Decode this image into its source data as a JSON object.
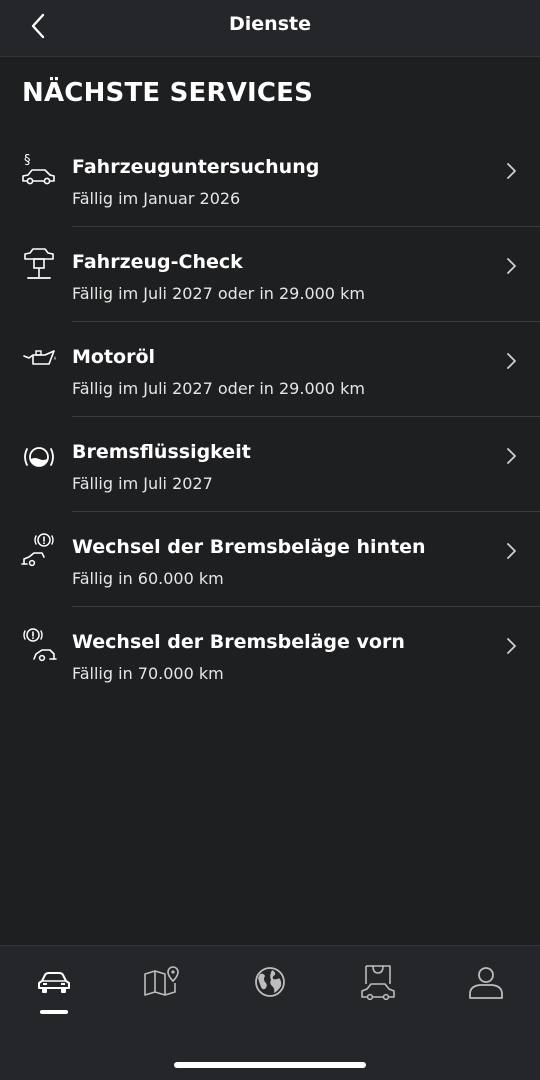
{
  "header": {
    "title": "Dienste",
    "back_icon": "chevron-left-icon"
  },
  "section": {
    "title": "NÄCHSTE SERVICES"
  },
  "services": [
    {
      "icon": "vehicle-inspection-icon",
      "title": "Fahrzeuguntersuchung",
      "subtitle": "Fällig im Januar 2026"
    },
    {
      "icon": "vehicle-lift-icon",
      "title": "Fahrzeug-Check",
      "subtitle": "Fällig im Juli 2027 oder in 29.000 km"
    },
    {
      "icon": "oil-can-icon",
      "title": "Motoröl",
      "subtitle": "Fällig im Juli 2027 oder in 29.000 km"
    },
    {
      "icon": "brake-fluid-icon",
      "title": "Bremsflüssigkeit",
      "subtitle": "Fällig im Juli 2027"
    },
    {
      "icon": "rear-brake-pads-icon",
      "title": "Wechsel der Bremsbeläge hinten",
      "subtitle": "Fällig in 60.000 km"
    },
    {
      "icon": "front-brake-pads-icon",
      "title": "Wechsel der Bremsbeläge vorn",
      "subtitle": "Fällig in 70.000 km"
    }
  ],
  "bottom_nav": {
    "tabs": [
      {
        "icon": "car-icon",
        "active": true
      },
      {
        "icon": "map-icon",
        "active": false
      },
      {
        "icon": "globe-icon",
        "active": false
      },
      {
        "icon": "shop-icon",
        "active": false
      },
      {
        "icon": "profile-icon",
        "active": false
      }
    ]
  },
  "colors": {
    "background": "#1e1f21",
    "bar": "#25262a",
    "divider": "#3a3b3f",
    "text": "#ffffff"
  }
}
